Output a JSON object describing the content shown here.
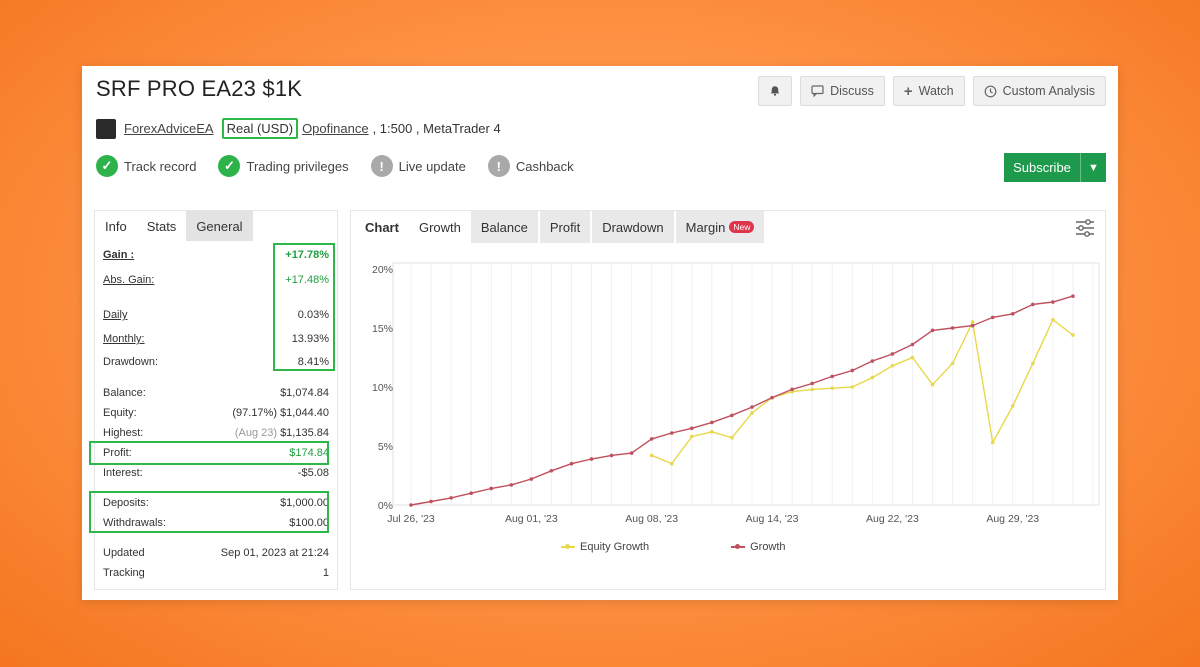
{
  "title": "SRF PRO EA23 $1K",
  "actions": {
    "bell_icon": "bell-icon",
    "discuss": "Discuss",
    "watch": "Watch",
    "custom_analysis": "Custom Analysis"
  },
  "meta": {
    "author": "ForexAdviceEA",
    "account_type": "Real (USD)",
    "broker": "Opofinance",
    "leverage_platform": ", 1:500 , MetaTrader 4"
  },
  "badges": [
    {
      "label": "Track record",
      "state": "ok"
    },
    {
      "label": "Trading privileges",
      "state": "ok"
    },
    {
      "label": "Live update",
      "state": "na"
    },
    {
      "label": "Cashback",
      "state": "na"
    }
  ],
  "subscribe": "Subscribe",
  "stats_tabs": [
    "Info",
    "Stats",
    "General"
  ],
  "stats": {
    "gain": {
      "label": "Gain :",
      "value": "+17.78%"
    },
    "abs_gain": {
      "label": "Abs. Gain:",
      "value": "+17.48%"
    },
    "daily": {
      "label": "Daily",
      "value": "0.03%"
    },
    "monthly": {
      "label": "Monthly:",
      "value": "13.93%"
    },
    "drawdown": {
      "label": "Drawdown:",
      "value": "8.41%"
    },
    "balance": {
      "label": "Balance:",
      "value": "$1,074.84"
    },
    "equity": {
      "label": "Equity:",
      "note": "(97.17%)",
      "value": "$1,044.40"
    },
    "highest": {
      "label": "Highest:",
      "note": "(Aug 23)",
      "value": "$1,135.84"
    },
    "profit": {
      "label": "Profit:",
      "value": "$174.84"
    },
    "interest": {
      "label": "Interest:",
      "value": "-$5.08"
    },
    "deposits": {
      "label": "Deposits:",
      "value": "$1,000.00"
    },
    "withdrawals": {
      "label": "Withdrawals:",
      "value": "$100.00"
    },
    "updated": {
      "label": "Updated",
      "value": "Sep 01, 2023 at 21:24"
    },
    "tracking": {
      "label": "Tracking",
      "value": "1"
    }
  },
  "chart_tabs": {
    "chart": "Chart",
    "growth": "Growth",
    "balance": "Balance",
    "profit": "Profit",
    "drawdown": "Drawdown",
    "margin": "Margin",
    "new_badge": "New"
  },
  "colors": {
    "accent_green": "#1e9a4c",
    "highlight_green": "#2fb84a",
    "equity_line": "#e8d84a",
    "growth_line": "#c0505e",
    "bars": "#86cc7a"
  },
  "chart_data": {
    "type": "line",
    "ylim": [
      0,
      20
    ],
    "y_ticks": [
      "0%",
      "5%",
      "10%",
      "15%",
      "20%"
    ],
    "x_ticks": [
      "Jul 26, '23",
      "Aug 01, '23",
      "Aug 08, '23",
      "Aug 14, '23",
      "Aug 22, '23",
      "Aug 29, '23"
    ],
    "x_tick_positions": [
      0,
      6,
      12,
      18,
      24,
      30
    ],
    "series": [
      {
        "name": "Equity Growth",
        "x": [
          12,
          13,
          14,
          15,
          16,
          17,
          18,
          19,
          20,
          21,
          22,
          23,
          24,
          25,
          26,
          27,
          28,
          29,
          30,
          31,
          32,
          33
        ],
        "y": [
          4.2,
          3.5,
          5.8,
          6.2,
          5.7,
          7.8,
          9.1,
          9.6,
          9.8,
          9.9,
          10.0,
          10.8,
          11.8,
          12.5,
          10.2,
          12.0,
          15.5,
          5.3,
          8.4,
          12.0,
          15.7,
          14.4
        ]
      },
      {
        "name": "Growth",
        "x": [
          0,
          1,
          2,
          3,
          4,
          5,
          6,
          7,
          8,
          9,
          10,
          11,
          12,
          13,
          14,
          15,
          16,
          17,
          18,
          19,
          20,
          21,
          22,
          23,
          24,
          25,
          26,
          27,
          28,
          29,
          30,
          31,
          32,
          33
        ],
        "y": [
          0,
          0.3,
          0.6,
          1.0,
          1.4,
          1.7,
          2.2,
          2.9,
          3.5,
          3.9,
          4.2,
          4.4,
          5.6,
          6.1,
          6.5,
          7.0,
          7.6,
          8.3,
          9.1,
          9.8,
          10.3,
          10.9,
          11.4,
          12.2,
          12.8,
          13.6,
          14.8,
          15.0,
          15.2,
          15.9,
          16.2,
          17.0,
          17.2,
          17.7
        ]
      }
    ],
    "legend": [
      "Equity Growth",
      "Growth"
    ],
    "legend_position": "bottom-center",
    "grid": "vertical"
  }
}
